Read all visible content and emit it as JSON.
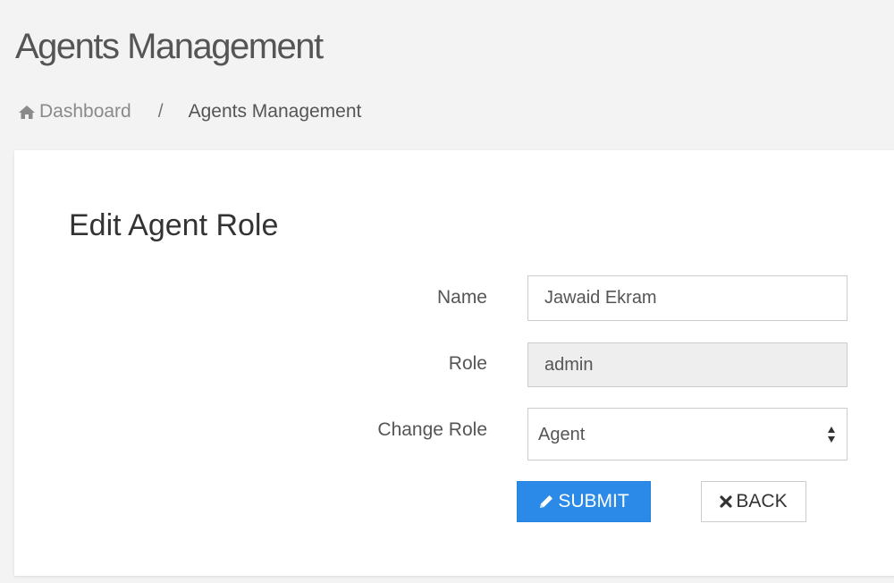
{
  "page": {
    "title": "Agents Management"
  },
  "breadcrumb": {
    "home_label": "Dashboard",
    "home_icon": "home-icon",
    "separator": "/",
    "current": "Agents Management"
  },
  "form": {
    "title": "Edit Agent Role",
    "name_label": "Name",
    "name_value": "Jawaid Ekram",
    "role_label": "Role",
    "role_value": "admin",
    "change_role_label": "Change Role",
    "change_role_selected": "Agent",
    "submit_label": "SUBMIT",
    "submit_icon": "pencil-icon",
    "back_label": "BACK",
    "back_icon": "close-icon"
  },
  "colors": {
    "primary": "#2b8ae8",
    "background": "#f3f3f3",
    "card": "#ffffff",
    "readonly_field": "#eeeeee"
  }
}
